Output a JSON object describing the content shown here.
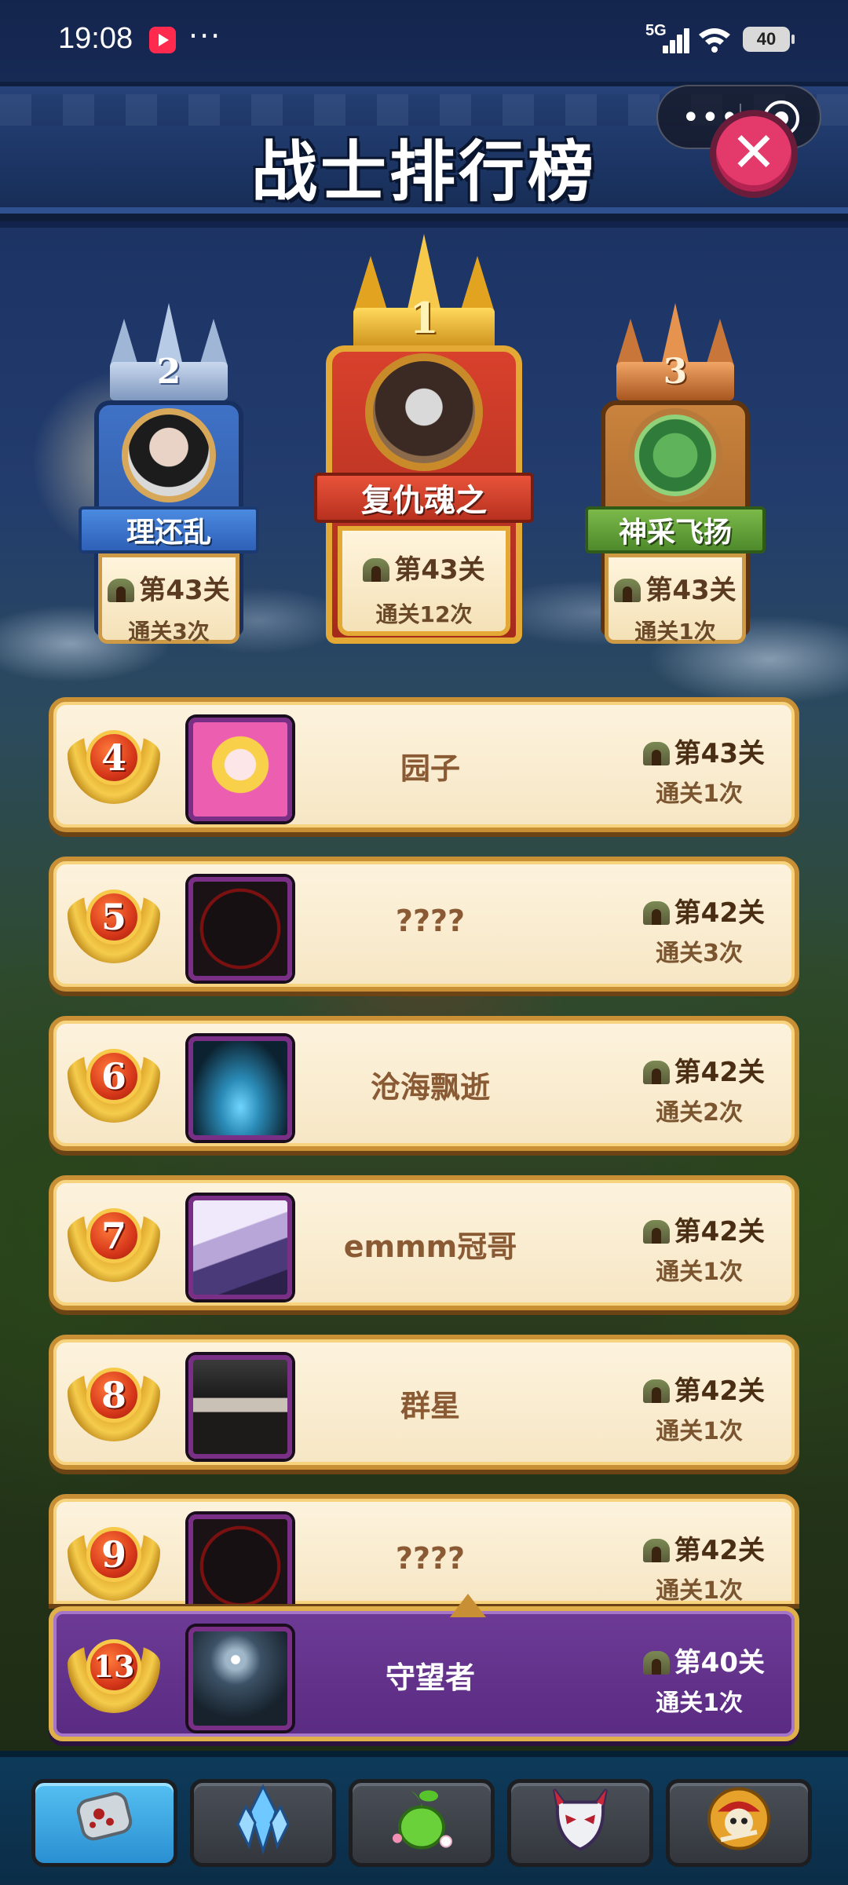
{
  "status_bar": {
    "time": "19:08",
    "dots": "···",
    "network": "5G",
    "battery": "40"
  },
  "header": {
    "title": "战士排行榜",
    "capsule_dots": "•••",
    "close_symbol": "✕"
  },
  "podium": [
    {
      "rank": "1",
      "name": "复仇魂之",
      "level": "第43关",
      "clears": "通关12次",
      "color": "gold"
    },
    {
      "rank": "2",
      "name": "理还乱",
      "level": "第43关",
      "clears": "通关3次",
      "color": "silver"
    },
    {
      "rank": "3",
      "name": "神采飞扬",
      "level": "第43关",
      "clears": "通关1次",
      "color": "bronze"
    }
  ],
  "list": [
    {
      "rank": "4",
      "name": "园子",
      "level": "第43关",
      "clears": "通关1次"
    },
    {
      "rank": "5",
      "name": "????",
      "level": "第42关",
      "clears": "通关3次"
    },
    {
      "rank": "6",
      "name": "沧海飘逝",
      "level": "第42关",
      "clears": "通关2次"
    },
    {
      "rank": "7",
      "name": "emmm冠哥",
      "level": "第42关",
      "clears": "通关1次"
    },
    {
      "rank": "8",
      "name": "群星",
      "level": "第42关",
      "clears": "通关1次"
    },
    {
      "rank": "9",
      "name": "????",
      "level": "第42关",
      "clears": "通关1次"
    }
  ],
  "self": {
    "rank": "13",
    "name": "守望者",
    "level": "第40关",
    "clears": "通关1次"
  },
  "bottom_nav": [
    {
      "icon": "dog-tag-icon",
      "active": true
    },
    {
      "icon": "crystal-icon",
      "active": false
    },
    {
      "icon": "fruit-icon",
      "active": false
    },
    {
      "icon": "mask-icon",
      "active": false
    },
    {
      "icon": "pirate-skull-icon",
      "active": false
    }
  ],
  "colors": {
    "accent_gold": "#f6c94a",
    "row_background": "#fdf3de",
    "self_row": "#6d3b96",
    "close_button": "#e43a6b"
  }
}
